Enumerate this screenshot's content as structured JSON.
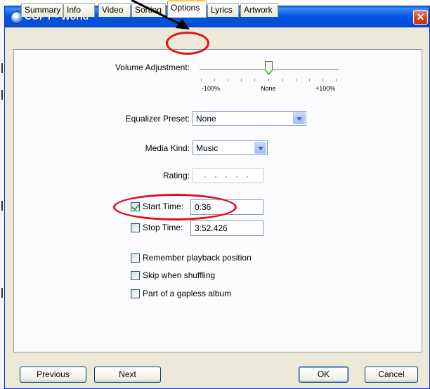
{
  "window": {
    "title": "COPY - World",
    "close_glyph": "✕"
  },
  "tabs": [
    {
      "label": "Summary",
      "active": false
    },
    {
      "label": "Info",
      "active": false
    },
    {
      "label": "Video",
      "active": false
    },
    {
      "label": "Sorting",
      "active": false
    },
    {
      "label": "Options",
      "active": true
    },
    {
      "label": "Lyrics",
      "active": false
    },
    {
      "label": "Artwork",
      "active": false
    }
  ],
  "options": {
    "volume": {
      "label": "Volume Adjustment:",
      "min_label": "-100%",
      "mid_label": "None",
      "max_label": "+100%",
      "value_percent": 0
    },
    "equalizer": {
      "label": "Equalizer Preset:",
      "value": "None"
    },
    "media_kind": {
      "label": "Media Kind:",
      "value": "Music"
    },
    "rating": {
      "label": "Rating:",
      "stars": 0
    },
    "start_time": {
      "label": "Start Time:",
      "value": "0:36",
      "checked": true
    },
    "stop_time": {
      "label": "Stop Time:",
      "value": "3:52.426",
      "checked": false
    },
    "remember": {
      "label": "Remember playback position",
      "checked": false
    },
    "skip": {
      "label": "Skip when shuffling",
      "checked": false
    },
    "gapless": {
      "label": "Part of a gapless album",
      "checked": false
    }
  },
  "buttons": {
    "previous": "Previous",
    "next": "Next",
    "ok": "OK",
    "cancel": "Cancel"
  },
  "colors": {
    "title_bar": "#0554e3",
    "annotation": "#e3101c",
    "checkmark": "#21a121"
  }
}
